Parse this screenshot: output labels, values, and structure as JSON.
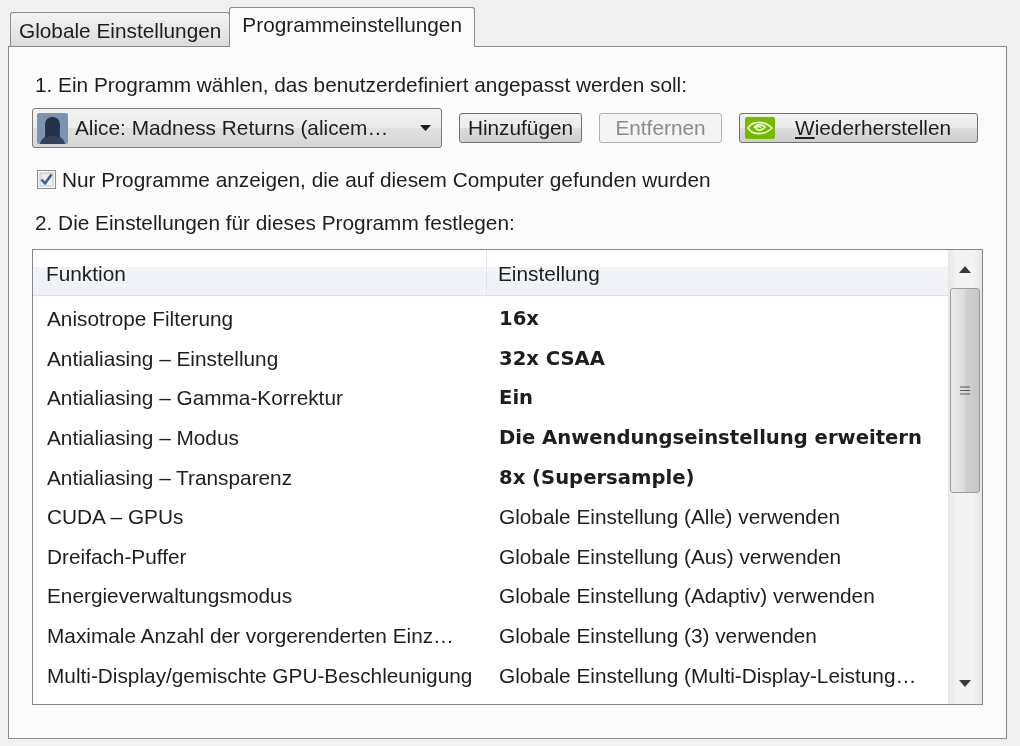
{
  "tabs": [
    {
      "label": "Globale Einstellungen",
      "selected": false
    },
    {
      "label": "Programmeinstellungen",
      "selected": true
    }
  ],
  "program_selection": {
    "label": "1. Ein Programm wählen, das benutzerdefiniert angepasst werden soll:",
    "program_dropdown": {
      "value": "Alice: Madness Returns (alicem…"
    },
    "buttons": [
      {
        "label": "Hinzufügen",
        "kind": "text",
        "disabled": false,
        "access_key_underlined": false
      },
      {
        "label": "Entfernen",
        "kind": "text",
        "disabled": true,
        "access_key_underlined": false
      },
      {
        "label": "Wiederherstellen",
        "kind": "icon",
        "disabled": false,
        "access_key_underlined": true
      }
    ],
    "show_found_only": {
      "label": "Nur Programme anzeigen, die auf diesem Computer gefunden wurden",
      "checked": true
    }
  },
  "program_settings": {
    "label": "2. Die Einstellungen für dieses Programm festlegen:",
    "table": {
      "columns": [
        "Funktion",
        "Einstellung"
      ],
      "rows": [
        {
          "function": "Anisotrope Filterung",
          "setting": "16x",
          "customized": true
        },
        {
          "function": "Antialiasing – Einstellung",
          "setting": "32x CSAA",
          "customized": true
        },
        {
          "function": "Antialiasing – Gamma-Korrektur",
          "setting": "Ein",
          "customized": true
        },
        {
          "function": "Antialiasing – Modus",
          "setting": "Die Anwendungseinstellung erweitern",
          "customized": true
        },
        {
          "function": "Antialiasing – Transparenz",
          "setting": "8x (Supersample)",
          "customized": true
        },
        {
          "function": "CUDA – GPUs",
          "setting": "Globale Einstellung (Alle) verwenden",
          "customized": false
        },
        {
          "function": "Dreifach-Puffer",
          "setting": "Globale Einstellung (Aus) verwenden",
          "customized": false
        },
        {
          "function": "Energieverwaltungsmodus",
          "setting": "Globale Einstellung (Adaptiv) verwenden",
          "customized": false
        },
        {
          "function": "Maximale Anzahl der vorgerenderten Einz…",
          "setting": "Globale Einstellung (3) verwenden",
          "customized": false
        },
        {
          "function": "Multi-Display/gemischte GPU-Beschleunigung",
          "setting": "Globale Einstellung (Multi-Display-Leistung…",
          "customized": false
        }
      ]
    }
  }
}
